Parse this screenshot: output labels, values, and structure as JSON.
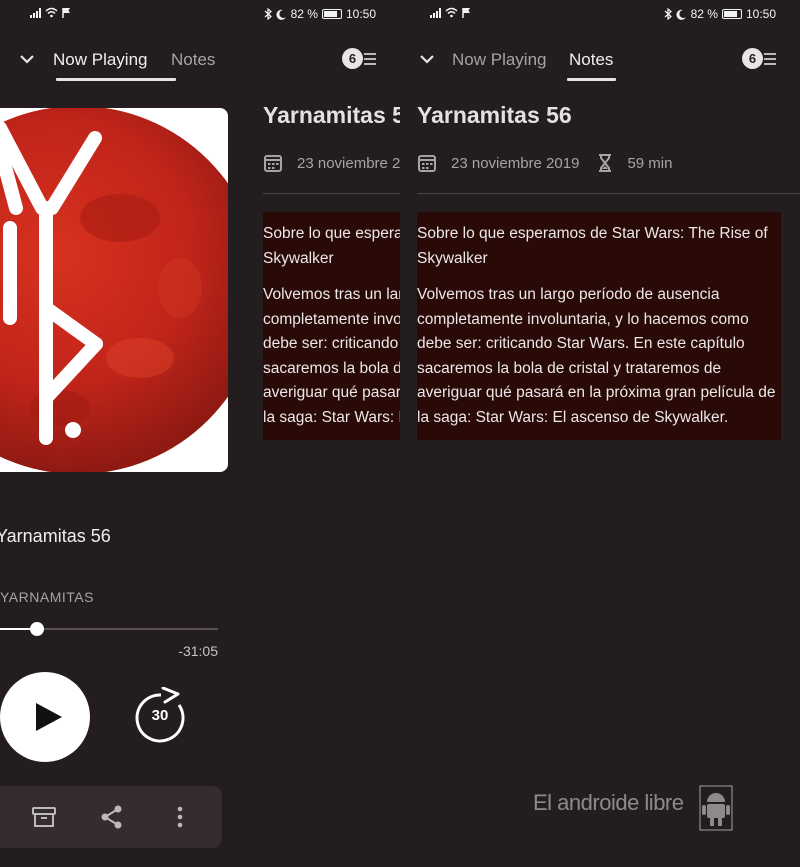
{
  "status_bar": {
    "battery": "82 %",
    "time": "10:50"
  },
  "tabs": {
    "now_playing": "Now Playing",
    "notes": "Notes"
  },
  "queue_count": "6",
  "episode": {
    "title": "Yarnamitas 56",
    "date": "23 noviembre 2019",
    "duration": "59 min",
    "podcast": "YARNAMITAS",
    "time_remaining": "-31:05",
    "progress": 0.17,
    "skip_seconds": "30"
  },
  "notes": {
    "headline": "Sobre lo que esperamos de Star Wars: The Rise of Skywalker",
    "body": "Volvemos tras un largo período de ausencia completamente involuntaria, y lo hacemos como debe ser: criticando Star Wars. En este capítulo sacaremos la bola de cristal y trataremos de averiguar qué pasará en la próxima gran película de la saga: Star Wars: El ascenso de Skywalker."
  },
  "watermark": "El androide libre",
  "icons": [
    "chevron-down-icon",
    "queue-icon",
    "calendar-icon",
    "hourglass-icon",
    "play-icon",
    "skip-forward-30-icon",
    "archive-icon",
    "share-icon",
    "more-vert-icon",
    "bluetooth-icon",
    "moon-icon",
    "battery-icon"
  ],
  "colors": {
    "background": "#231d20",
    "notes_background": "#2a0a07",
    "artwork_red": "#c8281a"
  }
}
